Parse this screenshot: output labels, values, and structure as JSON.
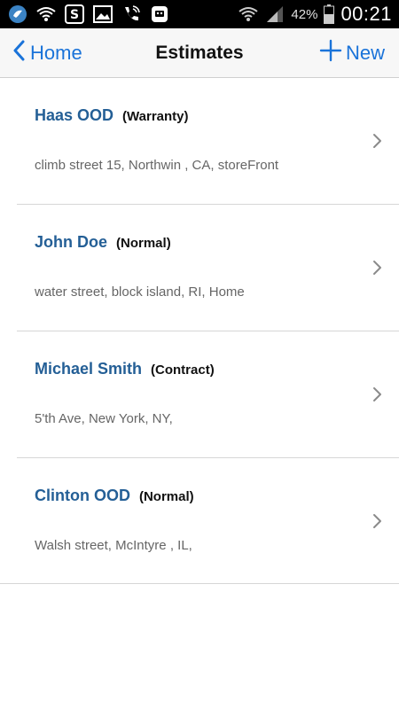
{
  "status_bar": {
    "battery_percent": "42%",
    "time": "00:21",
    "icons": [
      "app-bird-icon",
      "wifi-icon",
      "s-app-icon",
      "image-icon",
      "phone-wifi-icon",
      "robot-icon",
      "wifi-signal-icon",
      "cell-signal-icon",
      "battery-icon"
    ]
  },
  "nav": {
    "back_label": "Home",
    "title": "Estimates",
    "new_label": "New",
    "accent_color": "#1a73d9"
  },
  "estimates": [
    {
      "name": "Haas OOD",
      "type": "(Warranty)",
      "address": "climb street 15, Northwin , CA, storeFront"
    },
    {
      "name": "John Doe",
      "type": "(Normal)",
      "address": "water street, block island, RI, Home"
    },
    {
      "name": "Michael Smith",
      "type": "(Contract)",
      "address": "5'th Ave, New York, NY,"
    },
    {
      "name": "Clinton OOD",
      "type": "(Normal)",
      "address": "Walsh street, McIntyre , IL,"
    }
  ]
}
